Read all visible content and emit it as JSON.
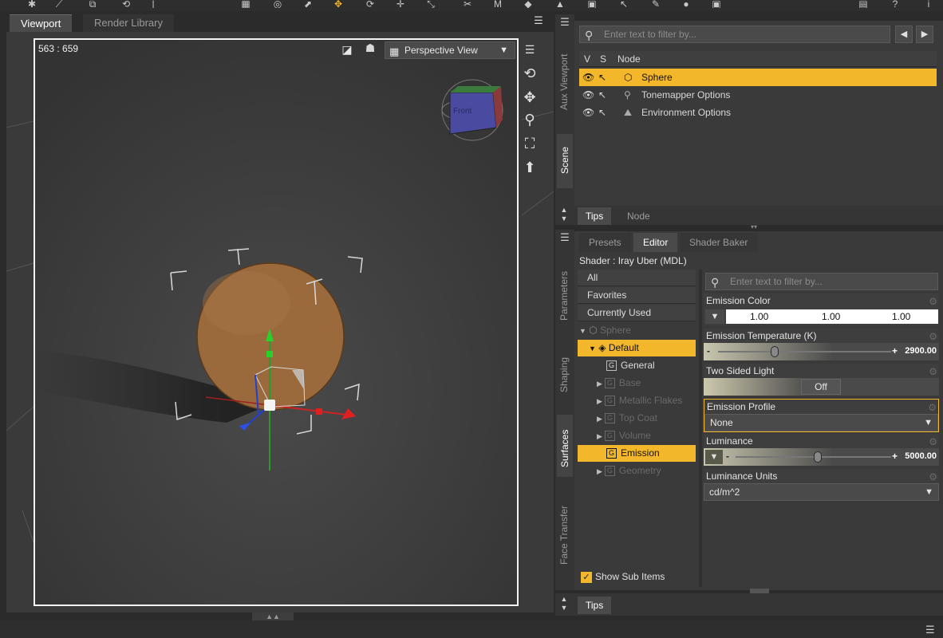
{
  "viewport_tabs": {
    "viewport": "Viewport",
    "render_library": "Render Library"
  },
  "viewport": {
    "coords": "563 : 659",
    "view_mode": "Perspective View",
    "cube_label": "Front"
  },
  "scene": {
    "filter_placeholder": "Enter text to filter by...",
    "col_v": "V",
    "col_s": "S",
    "col_node": "Node",
    "rows": [
      {
        "label": "Sphere",
        "selected": true
      },
      {
        "label": "Tonemapper Options",
        "selected": false
      },
      {
        "label": "Environment Options",
        "selected": false
      }
    ],
    "side_tabs": {
      "aux_viewport": "Aux Viewport",
      "scene": "Scene"
    },
    "bottom_tabs": {
      "tips": "Tips",
      "node": "Node"
    }
  },
  "surfaces": {
    "tabs": {
      "presets": "Presets",
      "editor": "Editor",
      "shader_baker": "Shader Baker"
    },
    "shader_label": "Shader : Iray Uber (MDL)",
    "side_tabs": {
      "parameters": "Parameters",
      "shaping": "Shaping",
      "surfaces": "Surfaces",
      "face_transfer": "Face Transfer"
    },
    "categories": [
      "All",
      "Favorites",
      "Currently Used"
    ],
    "tree": {
      "root": "Sphere",
      "material": "Default",
      "groups": [
        {
          "label": "General",
          "dim": false,
          "expandable": false,
          "selected": false
        },
        {
          "label": "Base",
          "dim": true,
          "expandable": true,
          "selected": false
        },
        {
          "label": "Metallic Flakes",
          "dim": true,
          "expandable": true,
          "selected": false
        },
        {
          "label": "Top Coat",
          "dim": true,
          "expandable": true,
          "selected": false
        },
        {
          "label": "Volume",
          "dim": true,
          "expandable": true,
          "selected": false
        },
        {
          "label": "Emission",
          "dim": false,
          "expandable": false,
          "selected": true
        },
        {
          "label": "Geometry",
          "dim": true,
          "expandable": true,
          "selected": false
        }
      ]
    },
    "show_sub_items": "Show Sub Items",
    "show_sub_items_checked": true,
    "filter_placeholder": "Enter text to filter by...",
    "properties": {
      "emission_color": {
        "label": "Emission Color",
        "r": "1.00",
        "g": "1.00",
        "b": "1.00"
      },
      "emission_temperature": {
        "label": "Emission Temperature (K)",
        "value": "2900.00",
        "level": 0.3
      },
      "two_sided_light": {
        "label": "Two Sided Light",
        "value": "Off"
      },
      "emission_profile": {
        "label": "Emission Profile",
        "value": "None"
      },
      "luminance": {
        "label": "Luminance",
        "value": "5000.00",
        "level": 0.5
      },
      "luminance_units": {
        "label": "Luminance Units",
        "value": "cd/m^2"
      }
    },
    "bottom_tab": "Tips"
  },
  "colors": {
    "accent": "#f2b72a",
    "sphere": "#9a6a3c",
    "viewport_bg": "#3c3c3c"
  }
}
